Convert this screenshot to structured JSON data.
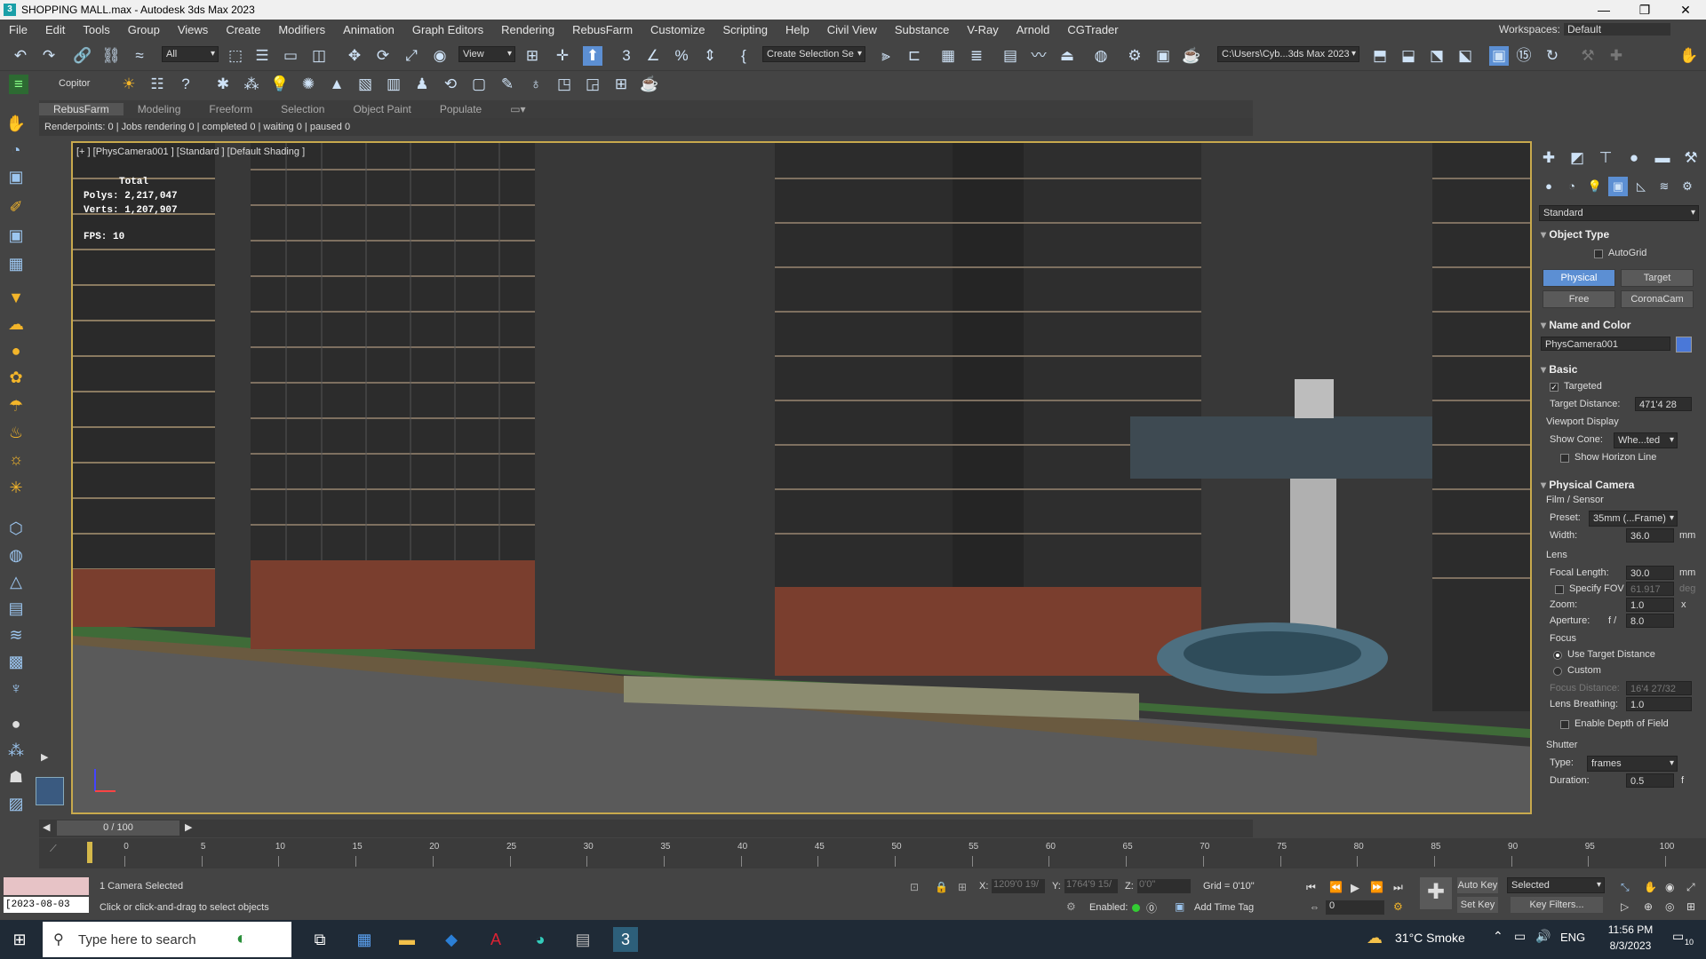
{
  "window": {
    "title": "SHOPPING MALL.max - Autodesk 3ds Max 2023",
    "app_icon": "3ds-max-icon"
  },
  "menu": [
    "File",
    "Edit",
    "Tools",
    "Group",
    "Views",
    "Create",
    "Modifiers",
    "Animation",
    "Graph Editors",
    "Rendering",
    "RebusFarm",
    "Customize",
    "Scripting",
    "Help",
    "Civil View",
    "Substance",
    "V-Ray",
    "Arnold",
    "CGTrader"
  ],
  "workspace": {
    "label": "Workspaces:",
    "value": "Default"
  },
  "toolbar": {
    "filter": "All",
    "ref_coord": "View",
    "selection_set": "Create Selection Se",
    "project_path": "C:\\Users\\Cyb...3ds Max 2023",
    "copilot": "Copitor"
  },
  "ribbon_tabs": [
    "RebusFarm",
    "Modeling",
    "Freeform",
    "Selection",
    "Object Paint",
    "Populate"
  ],
  "renderpoints": "Renderpoints: 0 | Jobs rendering 0 | completed 0 | waiting 0 | paused 0",
  "viewport": {
    "label": "[+ ] [PhysCamera001 ] [Standard ] [Default Shading ]",
    "stats_header": "Total",
    "polys_label": "Polys:",
    "polys": "2,217,047",
    "verts_label": "Verts:",
    "verts": "1,207,907",
    "fps_label": "FPS:",
    "fps": "10",
    "sky": "#383838",
    "ground": "#5a5a5a"
  },
  "command_panel": {
    "category": "Standard",
    "object_type": "Object Type",
    "autogrid": "AutoGrid",
    "buttons": [
      "Physical",
      "Target",
      "Free",
      "CoronaCam"
    ],
    "name_color": "Name and Color",
    "object_name": "PhysCamera001",
    "object_color": "#4a78d8",
    "basic": "Basic",
    "targeted": "Targeted",
    "target_distance_label": "Target Distance:",
    "target_distance": "471'4 28",
    "viewport_display": "Viewport Display",
    "show_cone_label": "Show Cone:",
    "show_cone": "Whe...ted",
    "show_horizon": "Show Horizon Line",
    "physical_camera": "Physical Camera",
    "film_sensor": "Film / Sensor",
    "preset_label": "Preset:",
    "preset": "35mm (...Frame)",
    "width_label": "Width:",
    "width": "36.0",
    "width_unit": "mm",
    "lens": "Lens",
    "focal_label": "Focal Length:",
    "focal": "30.0",
    "focal_unit": "mm",
    "specify_fov": "Specify FOV",
    "fov": "61.917",
    "fov_unit": "deg",
    "zoom_label": "Zoom:",
    "zoom": "1.0",
    "zoom_unit": "x",
    "aperture_label": "Aperture:",
    "aperture": "8.0",
    "aperture_prefix": "f /",
    "focus": "Focus",
    "use_target": "Use Target Distance",
    "custom": "Custom",
    "focus_distance_label": "Focus Distance:",
    "focus_distance": "16'4 27/32",
    "lens_breathing_label": "Lens Breathing:",
    "lens_breathing": "1.0",
    "dof": "Enable Depth of Field",
    "shutter": "Shutter",
    "type_label": "Type:",
    "type": "frames",
    "duration_label": "Duration:",
    "duration": "0.5",
    "duration_unit": "f"
  },
  "timeline": {
    "frame_display": "0 / 100",
    "ticks": [
      "0",
      "5",
      "10",
      "15",
      "20",
      "25",
      "30",
      "35",
      "40",
      "45",
      "50",
      "55",
      "60",
      "65",
      "70",
      "75",
      "80",
      "85",
      "90",
      "95",
      "100"
    ]
  },
  "status": {
    "selected": "1 Camera Selected",
    "prompt": "Click or click-and-drag to select objects",
    "date_field": "[2023-08-03",
    "x_label": "X:",
    "x": "1209'0 19/",
    "y_label": "Y:",
    "y": "1764'9 15/",
    "z_label": "Z:",
    "z": "0'0\"",
    "grid": "Grid = 0'10\"",
    "enabled": "Enabled:",
    "add_time_tag": "Add Time Tag",
    "auto_key": "Auto Key",
    "set_key": "Set Key",
    "selected_dd": "Selected",
    "key_filters": "Key Filters...",
    "frame_value": "0"
  },
  "taskbar": {
    "search": "Type here to search",
    "weather": "31°C  Smoke",
    "lang": "ENG",
    "time": "11:56 PM",
    "date": "8/3/2023",
    "notif": "10"
  }
}
